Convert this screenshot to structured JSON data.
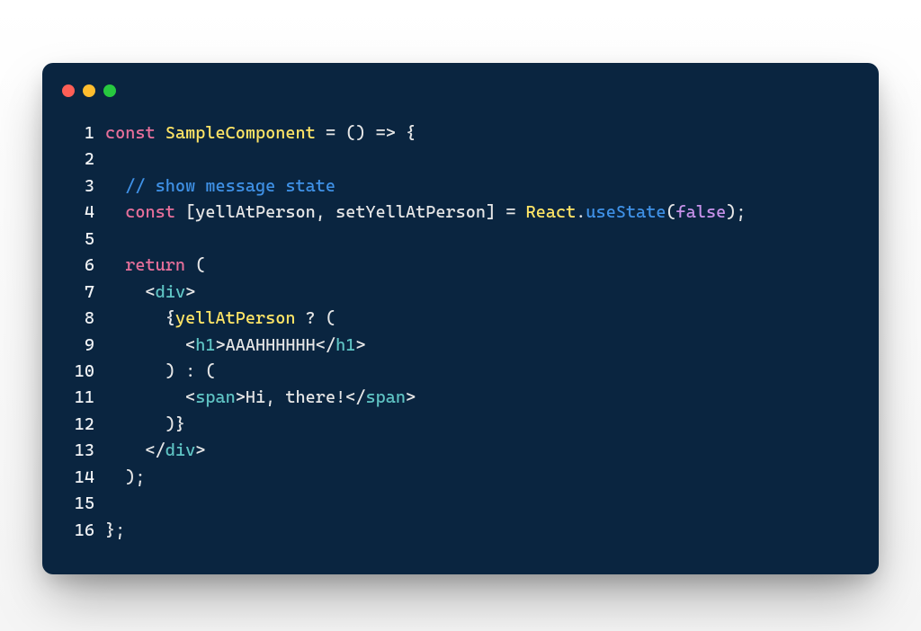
{
  "window": {
    "dots": [
      "red",
      "yellow",
      "green"
    ]
  },
  "code": {
    "lines": [
      {
        "n": 1,
        "tokens": [
          {
            "c": "tok-kw",
            "t": "const"
          },
          {
            "c": "tok-punc",
            "t": " "
          },
          {
            "c": "tok-id",
            "t": "SampleComponent"
          },
          {
            "c": "tok-punc",
            "t": " "
          },
          {
            "c": "tok-op",
            "t": "="
          },
          {
            "c": "tok-punc",
            "t": " ("
          },
          {
            "c": "tok-punc",
            "t": ") "
          },
          {
            "c": "tok-op",
            "t": "=>"
          },
          {
            "c": "tok-punc",
            "t": " {"
          }
        ]
      },
      {
        "n": 2,
        "tokens": []
      },
      {
        "n": 3,
        "tokens": [
          {
            "c": "tok-punc",
            "t": "  "
          },
          {
            "c": "tok-comment",
            "t": "// show message state"
          }
        ]
      },
      {
        "n": 4,
        "tokens": [
          {
            "c": "tok-punc",
            "t": "  "
          },
          {
            "c": "tok-kw",
            "t": "const"
          },
          {
            "c": "tok-punc",
            "t": " ["
          },
          {
            "c": "tok-var",
            "t": "yellAtPerson"
          },
          {
            "c": "tok-punc",
            "t": ", "
          },
          {
            "c": "tok-var",
            "t": "setYellAtPerson"
          },
          {
            "c": "tok-punc",
            "t": "] "
          },
          {
            "c": "tok-op",
            "t": "="
          },
          {
            "c": "tok-punc",
            "t": " "
          },
          {
            "c": "tok-id",
            "t": "React"
          },
          {
            "c": "tok-punc",
            "t": "."
          },
          {
            "c": "tok-func",
            "t": "useState"
          },
          {
            "c": "tok-punc",
            "t": "("
          },
          {
            "c": "tok-bool",
            "t": "false"
          },
          {
            "c": "tok-punc",
            "t": ");"
          }
        ]
      },
      {
        "n": 5,
        "tokens": []
      },
      {
        "n": 6,
        "tokens": [
          {
            "c": "tok-punc",
            "t": "  "
          },
          {
            "c": "tok-kw",
            "t": "return"
          },
          {
            "c": "tok-punc",
            "t": " ("
          }
        ]
      },
      {
        "n": 7,
        "tokens": [
          {
            "c": "tok-punc",
            "t": "    <"
          },
          {
            "c": "tok-tag",
            "t": "div"
          },
          {
            "c": "tok-punc",
            "t": ">"
          }
        ]
      },
      {
        "n": 8,
        "tokens": [
          {
            "c": "tok-punc",
            "t": "      {"
          },
          {
            "c": "tok-id",
            "t": "yellAtPerson"
          },
          {
            "c": "tok-punc",
            "t": " ? ("
          }
        ]
      },
      {
        "n": 9,
        "tokens": [
          {
            "c": "tok-punc",
            "t": "        <"
          },
          {
            "c": "tok-tag",
            "t": "h1"
          },
          {
            "c": "tok-punc",
            "t": ">"
          },
          {
            "c": "tok-text",
            "t": "AAAHHHHHH"
          },
          {
            "c": "tok-punc",
            "t": "</"
          },
          {
            "c": "tok-tag",
            "t": "h1"
          },
          {
            "c": "tok-punc",
            "t": ">"
          }
        ]
      },
      {
        "n": 10,
        "tokens": [
          {
            "c": "tok-punc",
            "t": "      ) : ("
          }
        ]
      },
      {
        "n": 11,
        "tokens": [
          {
            "c": "tok-punc",
            "t": "        <"
          },
          {
            "c": "tok-tag",
            "t": "span"
          },
          {
            "c": "tok-punc",
            "t": ">"
          },
          {
            "c": "tok-text",
            "t": "Hi, there!"
          },
          {
            "c": "tok-punc",
            "t": "</"
          },
          {
            "c": "tok-tag",
            "t": "span"
          },
          {
            "c": "tok-punc",
            "t": ">"
          }
        ]
      },
      {
        "n": 12,
        "tokens": [
          {
            "c": "tok-punc",
            "t": "      )}"
          }
        ]
      },
      {
        "n": 13,
        "tokens": [
          {
            "c": "tok-punc",
            "t": "    </"
          },
          {
            "c": "tok-tag",
            "t": "div"
          },
          {
            "c": "tok-punc",
            "t": ">"
          }
        ]
      },
      {
        "n": 14,
        "tokens": [
          {
            "c": "tok-punc",
            "t": "  );"
          }
        ]
      },
      {
        "n": 15,
        "tokens": []
      },
      {
        "n": 16,
        "tokens": [
          {
            "c": "tok-punc",
            "t": "};"
          }
        ]
      }
    ]
  }
}
